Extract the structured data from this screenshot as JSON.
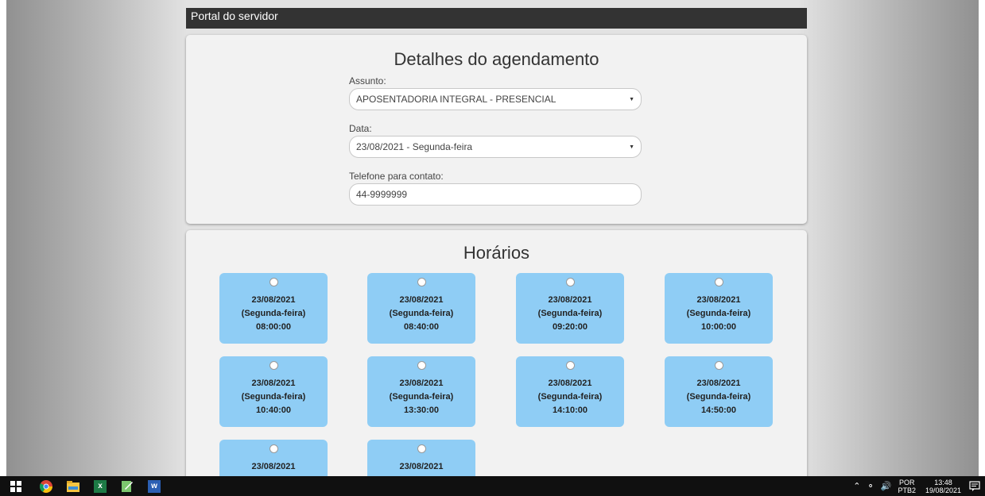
{
  "header": {
    "title": "Portal do servidor"
  },
  "details": {
    "title": "Detalhes do agendamento",
    "subject": {
      "label": "Assunto:",
      "value": "APOSENTADORIA INTEGRAL - PRESENCIAL"
    },
    "date": {
      "label": "Data:",
      "value": "23/08/2021 - Segunda-feira"
    },
    "phone": {
      "label": "Telefone para contato:",
      "value": "44-9999999"
    }
  },
  "slots": {
    "title": "Horários",
    "items": [
      {
        "date": "23/08/2021",
        "weekday": "(Segunda-feira)",
        "time": "08:00:00"
      },
      {
        "date": "23/08/2021",
        "weekday": "(Segunda-feira)",
        "time": "08:40:00"
      },
      {
        "date": "23/08/2021",
        "weekday": "(Segunda-feira)",
        "time": "09:20:00"
      },
      {
        "date": "23/08/2021",
        "weekday": "(Segunda-feira)",
        "time": "10:00:00"
      },
      {
        "date": "23/08/2021",
        "weekday": "(Segunda-feira)",
        "time": "10:40:00"
      },
      {
        "date": "23/08/2021",
        "weekday": "(Segunda-feira)",
        "time": "13:30:00"
      },
      {
        "date": "23/08/2021",
        "weekday": "(Segunda-feira)",
        "time": "14:10:00"
      },
      {
        "date": "23/08/2021",
        "weekday": "(Segunda-feira)",
        "time": "14:50:00"
      },
      {
        "date": "23/08/2021",
        "weekday": "",
        "time": ""
      },
      {
        "date": "23/08/2021",
        "weekday": "",
        "time": ""
      }
    ]
  },
  "taskbar": {
    "icons": [
      "windows-start-icon",
      "chrome-icon",
      "file-explorer-icon",
      "excel-icon",
      "notepad-icon",
      "word-icon"
    ],
    "lang_top": "POR",
    "lang_bottom": "PTB2",
    "time": "13:48",
    "date": "19/08/2021"
  },
  "colors": {
    "slot_bg": "#8fcdf5",
    "header_bg": "#333333",
    "card_bg": "#f2f2f2"
  }
}
